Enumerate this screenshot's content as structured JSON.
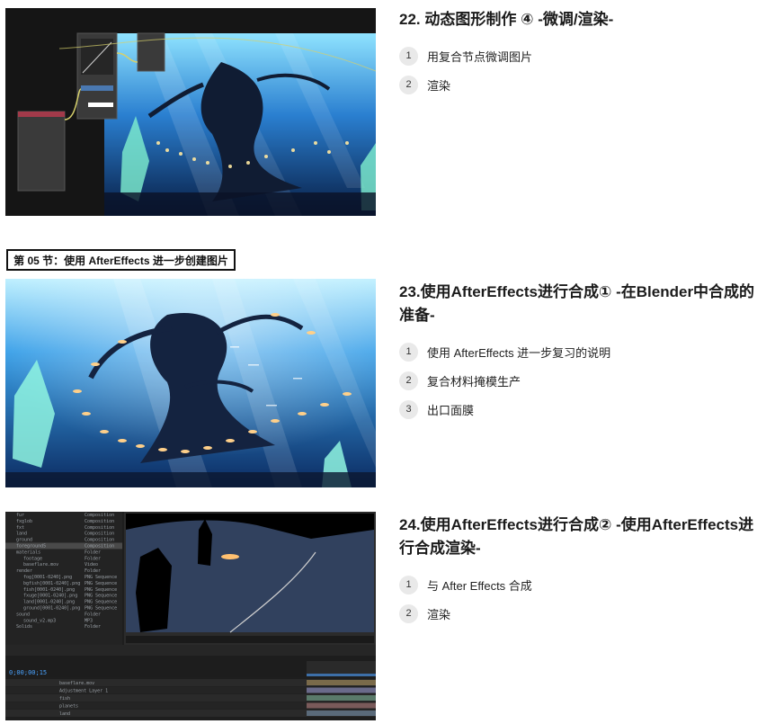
{
  "section_label": "第 05 节：使用 AfterEffects 进一步创建图片",
  "lessons": [
    {
      "title": "22. 动态图形制作 ④ -微调/渲染-",
      "items": [
        {
          "num": "1",
          "text": "用复合节点微调图片"
        },
        {
          "num": "2",
          "text": "渲染"
        }
      ]
    },
    {
      "title": "23.使用AfterEffects进行合成① -在Blender中合成的准备-",
      "items": [
        {
          "num": "1",
          "text": "使用 AfterEffects 进一步复习的说明"
        },
        {
          "num": "2",
          "text": "复合材料掩模生产"
        },
        {
          "num": "3",
          "text": "出口面膜"
        }
      ]
    },
    {
      "title": "24.使用AfterEffects进行合成② -使用AfterEffects进行合成渲染-",
      "items": [
        {
          "num": "1",
          "text": "与 After Effects 合成"
        },
        {
          "num": "2",
          "text": "渲染"
        }
      ]
    }
  ],
  "ae_project": {
    "rows": [
      "fur",
      "fxglob",
      "fxt",
      "land",
      "ground",
      "foreground5",
      "materials",
      "footage",
      "baseflare.mov",
      "render",
      "fog[0001-0240].png",
      "bgfish[0001-0240].png",
      "fish[0001-0240].png",
      "fxuge[0001-0240].png",
      "land[0001-0240].png",
      "ground[0001-0240].png",
      "sound",
      "sound_v2.mp3",
      "Solids"
    ],
    "types": [
      "Composition",
      "Composition",
      "Composition",
      "Composition",
      "Composition",
      "Composition",
      "Folder",
      "Folder",
      "Video",
      "Folder",
      "PNG Sequence",
      "PNG Sequence",
      "PNG Sequence",
      "PNG Sequence",
      "PNG Sequence",
      "PNG Sequence",
      "Folder",
      "MP3",
      "Folder"
    ]
  },
  "ae_timeline": {
    "timecode": "0;00;00;15",
    "layers": [
      "baseflare.mov",
      "Adjustment Layer 1",
      "fish",
      "planets",
      "land"
    ]
  },
  "colors": {
    "accent": "#1b1b1b",
    "badge_bg": "#e9e9e9"
  }
}
